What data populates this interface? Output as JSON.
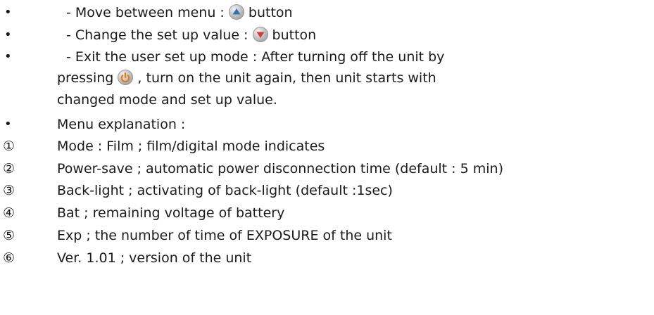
{
  "lines": {
    "move_pre": "- Move between menu  : ",
    "move_post": " button",
    "change_pre": "- Change the set up value : ",
    "change_post": " button",
    "exit_line1": "- Exit the user set up mode : After turning off the unit by",
    "exit_line2_pre": "pressing ",
    "exit_line2_post": " , turn  on the unit again, then unit starts with",
    "exit_line3": "changed mode and set up value.",
    "menu_explanation": "Menu explanation :"
  },
  "bullet_symbol": "•",
  "icons": {
    "up": "up-arrow-button-icon",
    "down": "down-arrow-button-icon",
    "power": "power-button-icon",
    "up_color": "#3a6fb0",
    "down_color": "#d23a3a",
    "power_color": "#e07a1a"
  },
  "menu_items": [
    {
      "num": "①",
      "text": "Mode : Film ; film/digital mode indicates"
    },
    {
      "num": "②",
      "text": "Power-save ; automatic power disconnection time (default : 5 min)"
    },
    {
      "num": "③",
      "text": "Back-light ; activating of back-light (default :1sec)"
    },
    {
      "num": "④",
      "text": "Bat ; remaining voltage of battery"
    },
    {
      "num": "⑤",
      "text": "Exp ; the number of time of EXPOSURE of the unit"
    },
    {
      "num": "⑥",
      "text": "Ver. 1.01 ; version of the unit"
    }
  ]
}
